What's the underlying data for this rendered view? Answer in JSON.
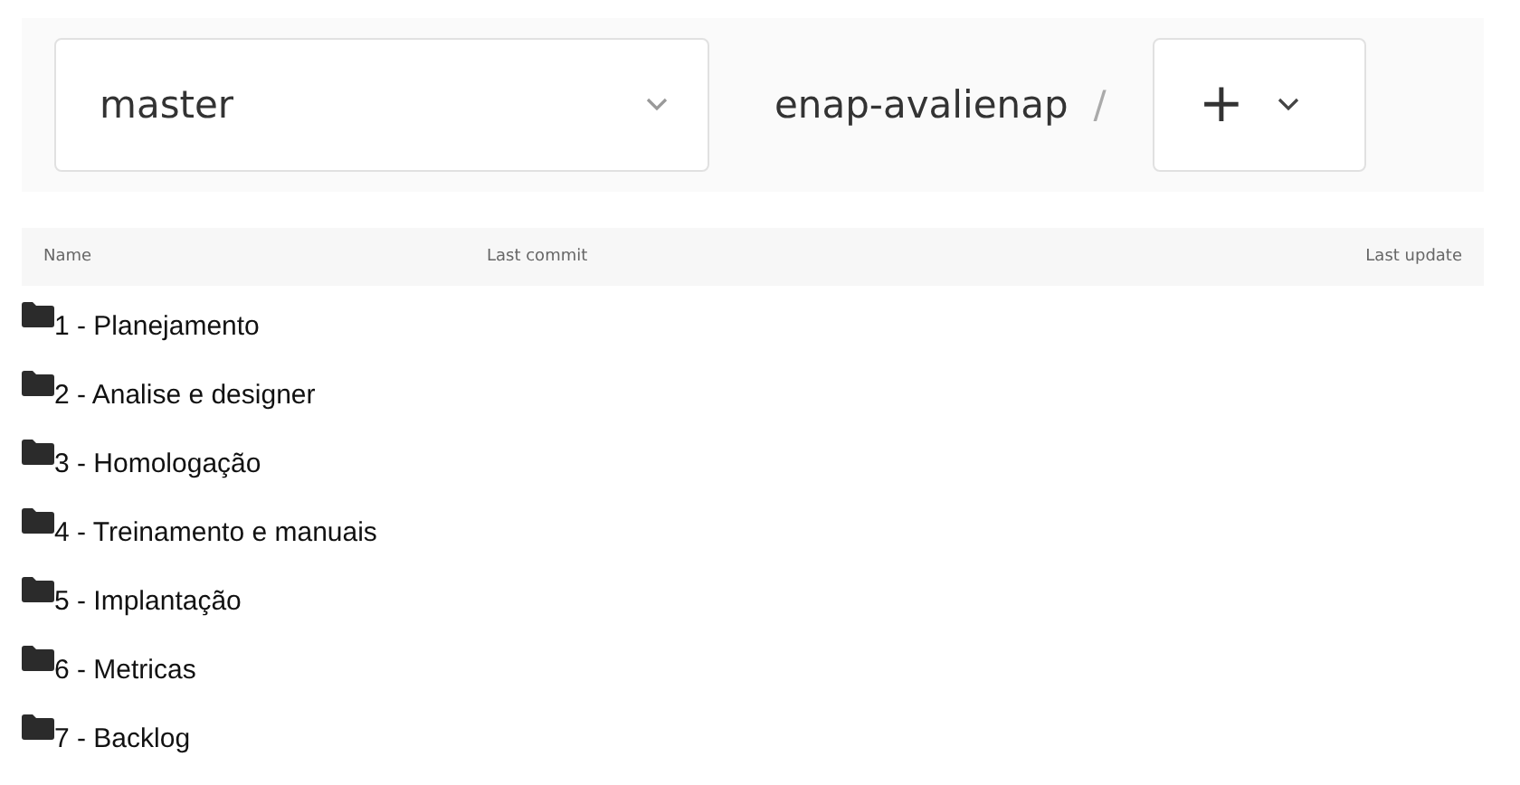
{
  "branch_selector": {
    "value": "master"
  },
  "breadcrumb": {
    "repo": "enap-avalienap",
    "separator": "/"
  },
  "add_button": {
    "label": "+"
  },
  "table": {
    "columns": [
      "Name",
      "Last commit",
      "Last update"
    ],
    "rows": [
      {
        "name": "1 - Planejamento",
        "kind": "folder"
      },
      {
        "name": "2 - Analise e designer",
        "kind": "folder"
      },
      {
        "name": "3 - Homologação",
        "kind": "folder"
      },
      {
        "name": "4 - Treinamento e manuais",
        "kind": "folder"
      },
      {
        "name": "5 - Implantação",
        "kind": "folder"
      },
      {
        "name": "6 - Metricas",
        "kind": "folder"
      },
      {
        "name": "7 - Backlog",
        "kind": "folder"
      }
    ]
  }
}
